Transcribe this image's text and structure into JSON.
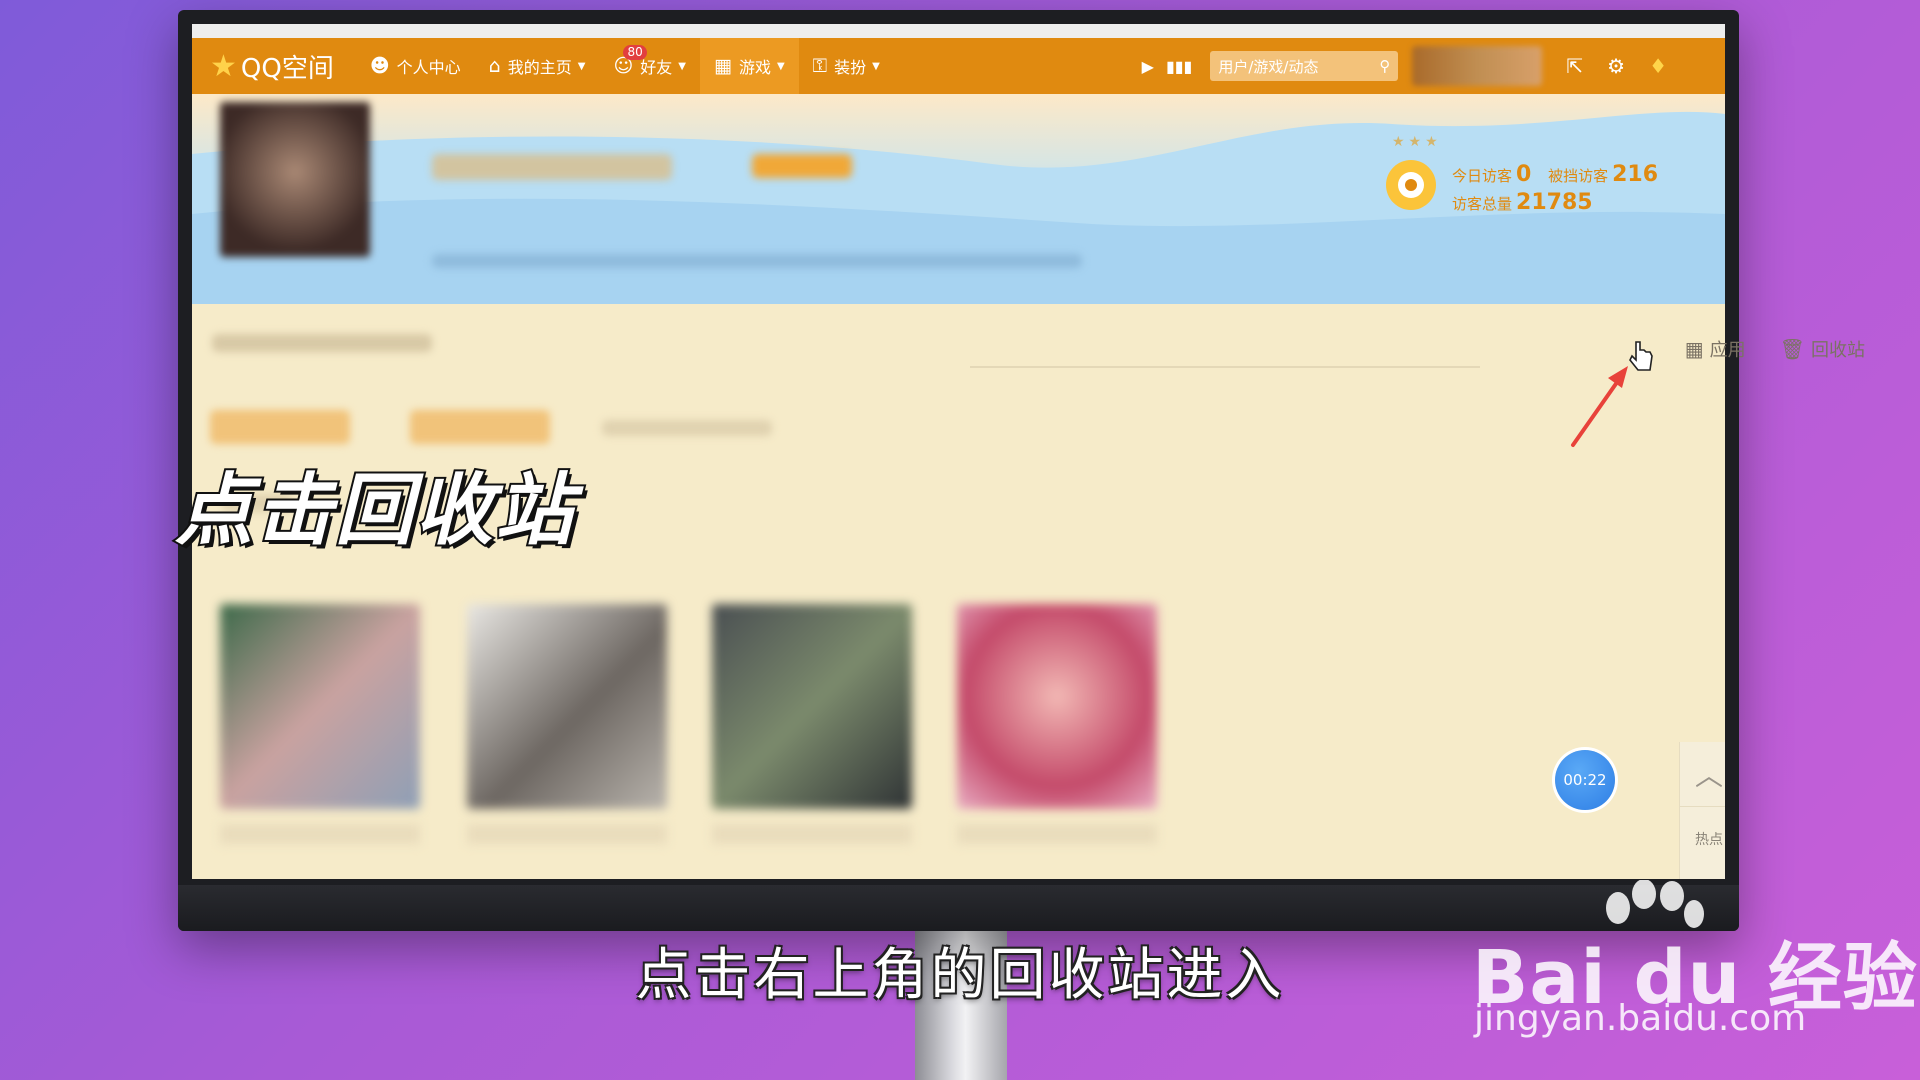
{
  "navbar": {
    "logo": "QQ空间",
    "items": [
      {
        "label": "个人中心",
        "icon": "person-icon"
      },
      {
        "label": "我的主页",
        "icon": "home-icon"
      },
      {
        "label": "好友",
        "icon": "friends-icon",
        "badge": "80"
      },
      {
        "label": "游戏",
        "icon": "grid-icon"
      },
      {
        "label": "装扮",
        "icon": "shirt-icon"
      }
    ],
    "search_placeholder": "用户/游戏/动态"
  },
  "visitors": {
    "today_label": "今日访客",
    "today_value": "0",
    "blocked_label": "被挡访客",
    "blocked_value": "216",
    "total_label": "访客总量",
    "total_value": "21785"
  },
  "toolbar": {
    "apps_label": "应用",
    "recycle_label": "回收站"
  },
  "timer": "00:22",
  "side": {
    "hot_label": "热点"
  },
  "overlay": {
    "title": "点击回收站",
    "subtitle": "点击右上角的回收站进入"
  },
  "watermark": {
    "brand": "Bai du 经验",
    "url": "jingyan.baidu.com"
  },
  "colors": {
    "nav_bg": "#e08a10",
    "cover_blue": "#a9d6f2",
    "content_bg": "#f6ebc9",
    "arrow": "#e8423a"
  }
}
